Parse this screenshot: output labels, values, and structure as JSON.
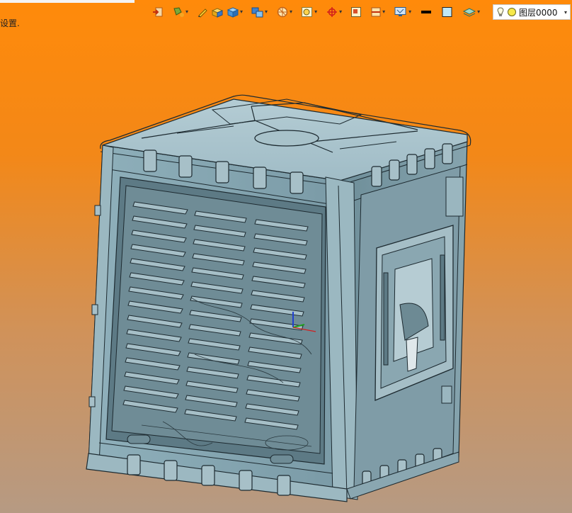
{
  "window": {
    "status_text": "设置.",
    "background_top": "#ff8a0a",
    "background_bottom": "#b69a83"
  },
  "toolbar": {
    "buttons": [
      {
        "name": "exit-sketch-button",
        "icon": "exit-icon"
      },
      {
        "name": "paint-button",
        "icon": "paint-bucket-icon",
        "dropdown": true
      },
      {
        "name": "pencil-button",
        "icon": "pencil-icon"
      },
      {
        "name": "shaded-solid-button",
        "icon": "shaded-box-icon"
      },
      {
        "name": "solid-display-button",
        "icon": "cube-icon",
        "dropdown": true
      },
      {
        "name": "view-style-button",
        "icon": "view-cubes-icon",
        "dropdown": true
      },
      {
        "name": "render-button",
        "icon": "render-sphere-icon",
        "dropdown": true
      },
      {
        "name": "zoom-fit-button",
        "icon": "zoom-fit-icon",
        "dropdown": true
      },
      {
        "name": "snap-button",
        "icon": "crosshair-icon",
        "dropdown": true
      },
      {
        "name": "window-select-button",
        "icon": "window-select-icon"
      },
      {
        "name": "section-button",
        "icon": "section-view-icon",
        "dropdown": true
      },
      {
        "name": "display-mode-button",
        "icon": "monitor-icon",
        "dropdown": true
      },
      {
        "name": "line-color-button",
        "icon": "line-color-icon"
      },
      {
        "name": "fill-color-button",
        "icon": "fill-color-icon"
      },
      {
        "name": "layers-button",
        "icon": "layers-icon",
        "dropdown": true
      }
    ]
  },
  "layer": {
    "label": "图层0000",
    "visible_icon": "bulb-icon",
    "color_icon": "yellow-circle-icon"
  },
  "model": {
    "name": "evaporative-air-cooler-model",
    "body_color": "#98b6c0",
    "edge_color": "#1d2a30"
  }
}
